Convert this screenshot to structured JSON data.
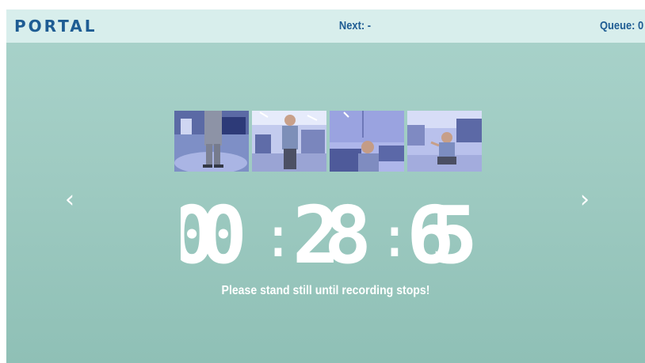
{
  "header": {
    "logo": "PORTAL",
    "next_label": "Next: -",
    "queue_label": "Queue: 0"
  },
  "camera_views": [
    {
      "name": "camera-1",
      "scene": "legs-standing"
    },
    {
      "name": "camera-2",
      "scene": "person-side"
    },
    {
      "name": "camera-3",
      "scene": "person-head"
    },
    {
      "name": "camera-4",
      "scene": "person-crouched"
    }
  ],
  "timer": {
    "minutes": "00",
    "seconds": "28",
    "hundredths": "65",
    "separator": ":"
  },
  "message": "Please stand still until recording stops!",
  "icons": {
    "prev": "chevron-left-icon",
    "next": "chevron-right-icon"
  },
  "colors": {
    "brand": "#1e5c93",
    "header_bg": "#d8eeec",
    "background": "#9fcbc2",
    "timer": "#ffffff"
  }
}
